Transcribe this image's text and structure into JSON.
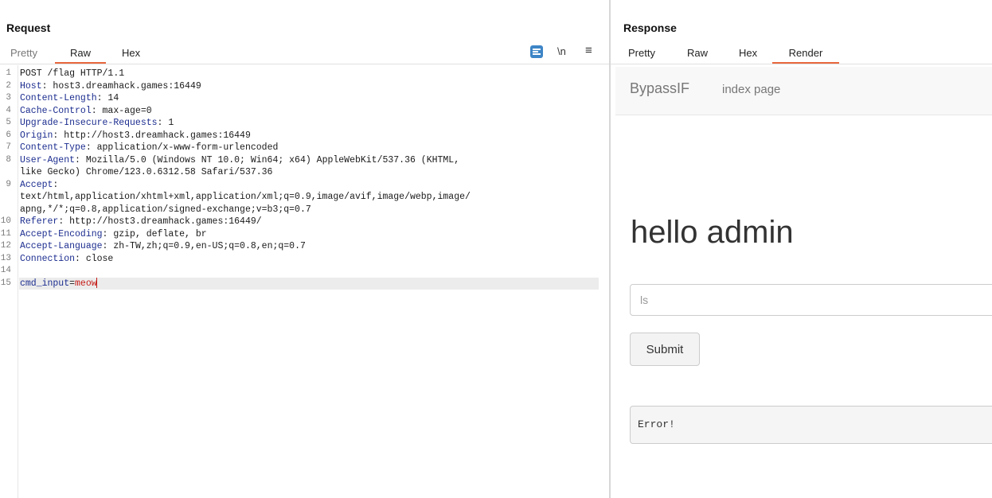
{
  "request": {
    "title": "Request",
    "tabs": [
      "Pretty",
      "Raw",
      "Hex"
    ],
    "active_tab": "Raw",
    "tools": {
      "newline_label": "\\n",
      "menu_glyph": "≡"
    },
    "lines": [
      {
        "n": "1",
        "text": "POST /flag HTTP/1.1"
      },
      {
        "n": "2",
        "name": "Host",
        "value": ": host3.dreamhack.games:16449"
      },
      {
        "n": "3",
        "name": "Content-Length",
        "value": ": 14"
      },
      {
        "n": "4",
        "name": "Cache-Control",
        "value": ": max-age=0"
      },
      {
        "n": "5",
        "name": "Upgrade-Insecure-Requests",
        "value": ": 1"
      },
      {
        "n": "6",
        "name": "Origin",
        "value": ": http://host3.dreamhack.games:16449"
      },
      {
        "n": "7",
        "name": "Content-Type",
        "value": ": application/x-www-form-urlencoded"
      },
      {
        "n": "8",
        "name": "User-Agent",
        "value": ": Mozilla/5.0 (Windows NT 10.0; Win64; x64) AppleWebKit/537.36 (KHTML,"
      },
      {
        "n": "",
        "text": "like Gecko) Chrome/123.0.6312.58 Safari/537.36"
      },
      {
        "n": "9",
        "name": "Accept",
        "value": ":"
      },
      {
        "n": "",
        "text": "text/html,application/xhtml+xml,application/xml;q=0.9,image/avif,image/webp,image/"
      },
      {
        "n": "",
        "text": "apng,*/*;q=0.8,application/signed-exchange;v=b3;q=0.7"
      },
      {
        "n": "10",
        "name": "Referer",
        "value": ": http://host3.dreamhack.games:16449/"
      },
      {
        "n": "11",
        "name": "Accept-Encoding",
        "value": ": gzip, deflate, br"
      },
      {
        "n": "12",
        "name": "Accept-Language",
        "value": ": zh-TW,zh;q=0.9,en-US;q=0.8,en;q=0.7"
      },
      {
        "n": "13",
        "name": "Connection",
        "value": ": close"
      },
      {
        "n": "14",
        "text": ""
      },
      {
        "n": "15",
        "param": "cmd_input",
        "eq": "=",
        "pval": "meow",
        "highlight": true
      }
    ]
  },
  "response": {
    "title": "Response",
    "tabs": [
      "Pretty",
      "Raw",
      "Hex",
      "Render"
    ],
    "active_tab": "Render",
    "render": {
      "brand": "BypassIF",
      "nav_link": "index page",
      "heading": "hello admin",
      "input_placeholder": "ls",
      "submit_label": "Submit",
      "result_text": "Error!"
    }
  },
  "colors": {
    "accent": "#e8663d",
    "wrap_button": "#3d85c6",
    "header_name": "#1c2d8f",
    "param_value": "#c41a16"
  }
}
